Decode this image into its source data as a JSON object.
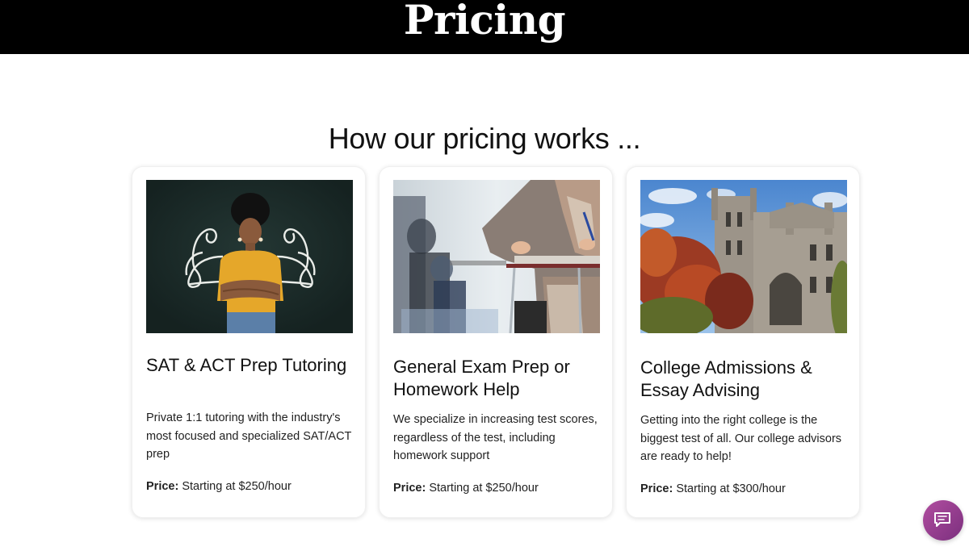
{
  "hero": {
    "title": "Pricing"
  },
  "section": {
    "title": "How our pricing works ..."
  },
  "cards": [
    {
      "title": "SAT & ACT Prep Tutoring",
      "description": "Private 1:1 tutoring with the industry's most focused and specialized SAT/ACT prep",
      "price_label": "Price:",
      "price_value": "Starting at $250/hour"
    },
    {
      "title": "General Exam Prep or Homework Help",
      "description": "We specialize in increasing test scores, regardless of the test, including homework support",
      "price_label": "Price:",
      "price_value": "Starting at $250/hour"
    },
    {
      "title": "College Admissions & Essay Advising",
      "description": "Getting into the right college is the biggest test of all. Our college advisors are ready to help!",
      "price_label": "Price:",
      "price_value": "Starting at $300/hour"
    }
  ],
  "chat_widget": {
    "icon": "chat-bubble-icon",
    "color": "#9b3f92"
  }
}
